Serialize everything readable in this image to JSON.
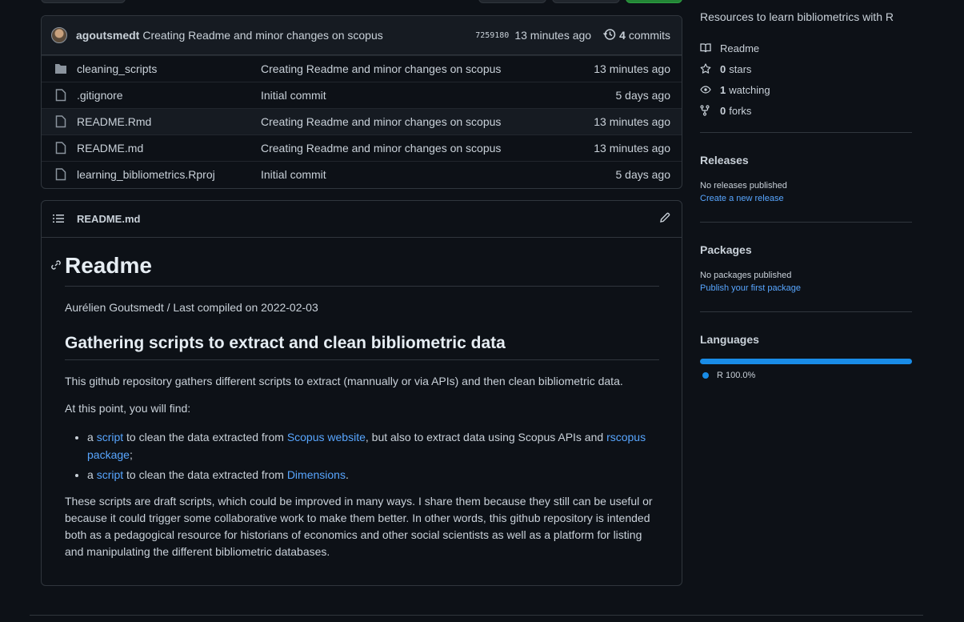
{
  "commit_bar": {
    "author": "agoutsmedt",
    "message": "Creating Readme and minor changes on scopus",
    "sha": "7259180",
    "age": "13 minutes ago",
    "commit_count": "4",
    "commit_word": "commits"
  },
  "files": [
    {
      "name": "cleaning_scripts",
      "type": "folder",
      "message": "Creating Readme and minor changes on scopus",
      "age": "13 minutes ago"
    },
    {
      "name": ".gitignore",
      "type": "file",
      "message": "Initial commit",
      "age": "5 days ago"
    },
    {
      "name": "README.Rmd",
      "type": "file",
      "message": "Creating Readme and minor changes on scopus",
      "age": "13 minutes ago"
    },
    {
      "name": "README.md",
      "type": "file",
      "message": "Creating Readme and minor changes on scopus",
      "age": "13 minutes ago"
    },
    {
      "name": "learning_bibliometrics.Rproj",
      "type": "file",
      "message": "Initial commit",
      "age": "5 days ago"
    }
  ],
  "readme": {
    "filename": "README.md",
    "h1": "Readme",
    "byline": "Aurélien Goutsmedt / Last compiled on 2022-02-03",
    "h2": "Gathering scripts to extract and clean bibliometric data",
    "p1": "This github repository gathers different scripts to extract (mannually or via APIs) and then clean bibliometric data.",
    "p2": "At this point, you will find:",
    "li1": {
      "a": "a ",
      "link1": "script",
      "t1": " to clean the data extracted from ",
      "link2": "Scopus website",
      "t2": ", but also to extract data using Scopus APIs and ",
      "link3": "rscopus package",
      "t3": ";"
    },
    "li2": {
      "a": "a ",
      "link1": "script",
      "t1": " to clean the data extracted from ",
      "link2": "Dimensions",
      "t2": "."
    },
    "p3": "These scripts are draft scripts, which could be improved in many ways. I share them because they still can be useful or because it could trigger some collaborative work to make them better. In other words, this github repository is intended both as a pedagogical resource for historians of economics and other social scientists as well as a platform for listing and manipulating the different bibliometric databases."
  },
  "sidebar": {
    "about": "Resources to learn bibliometrics with R",
    "readme_label": "Readme",
    "stars_count": "0",
    "stars_label": "stars",
    "watching_count": "1",
    "watching_label": "watching",
    "forks_count": "0",
    "forks_label": "forks",
    "releases_title": "Releases",
    "releases_none": "No releases published",
    "releases_link": "Create a new release",
    "packages_title": "Packages",
    "packages_none": "No packages published",
    "packages_link": "Publish your first package",
    "languages_title": "Languages",
    "languages": [
      {
        "name": "R",
        "percent": "100.0%",
        "color": "#198ce7"
      }
    ]
  }
}
